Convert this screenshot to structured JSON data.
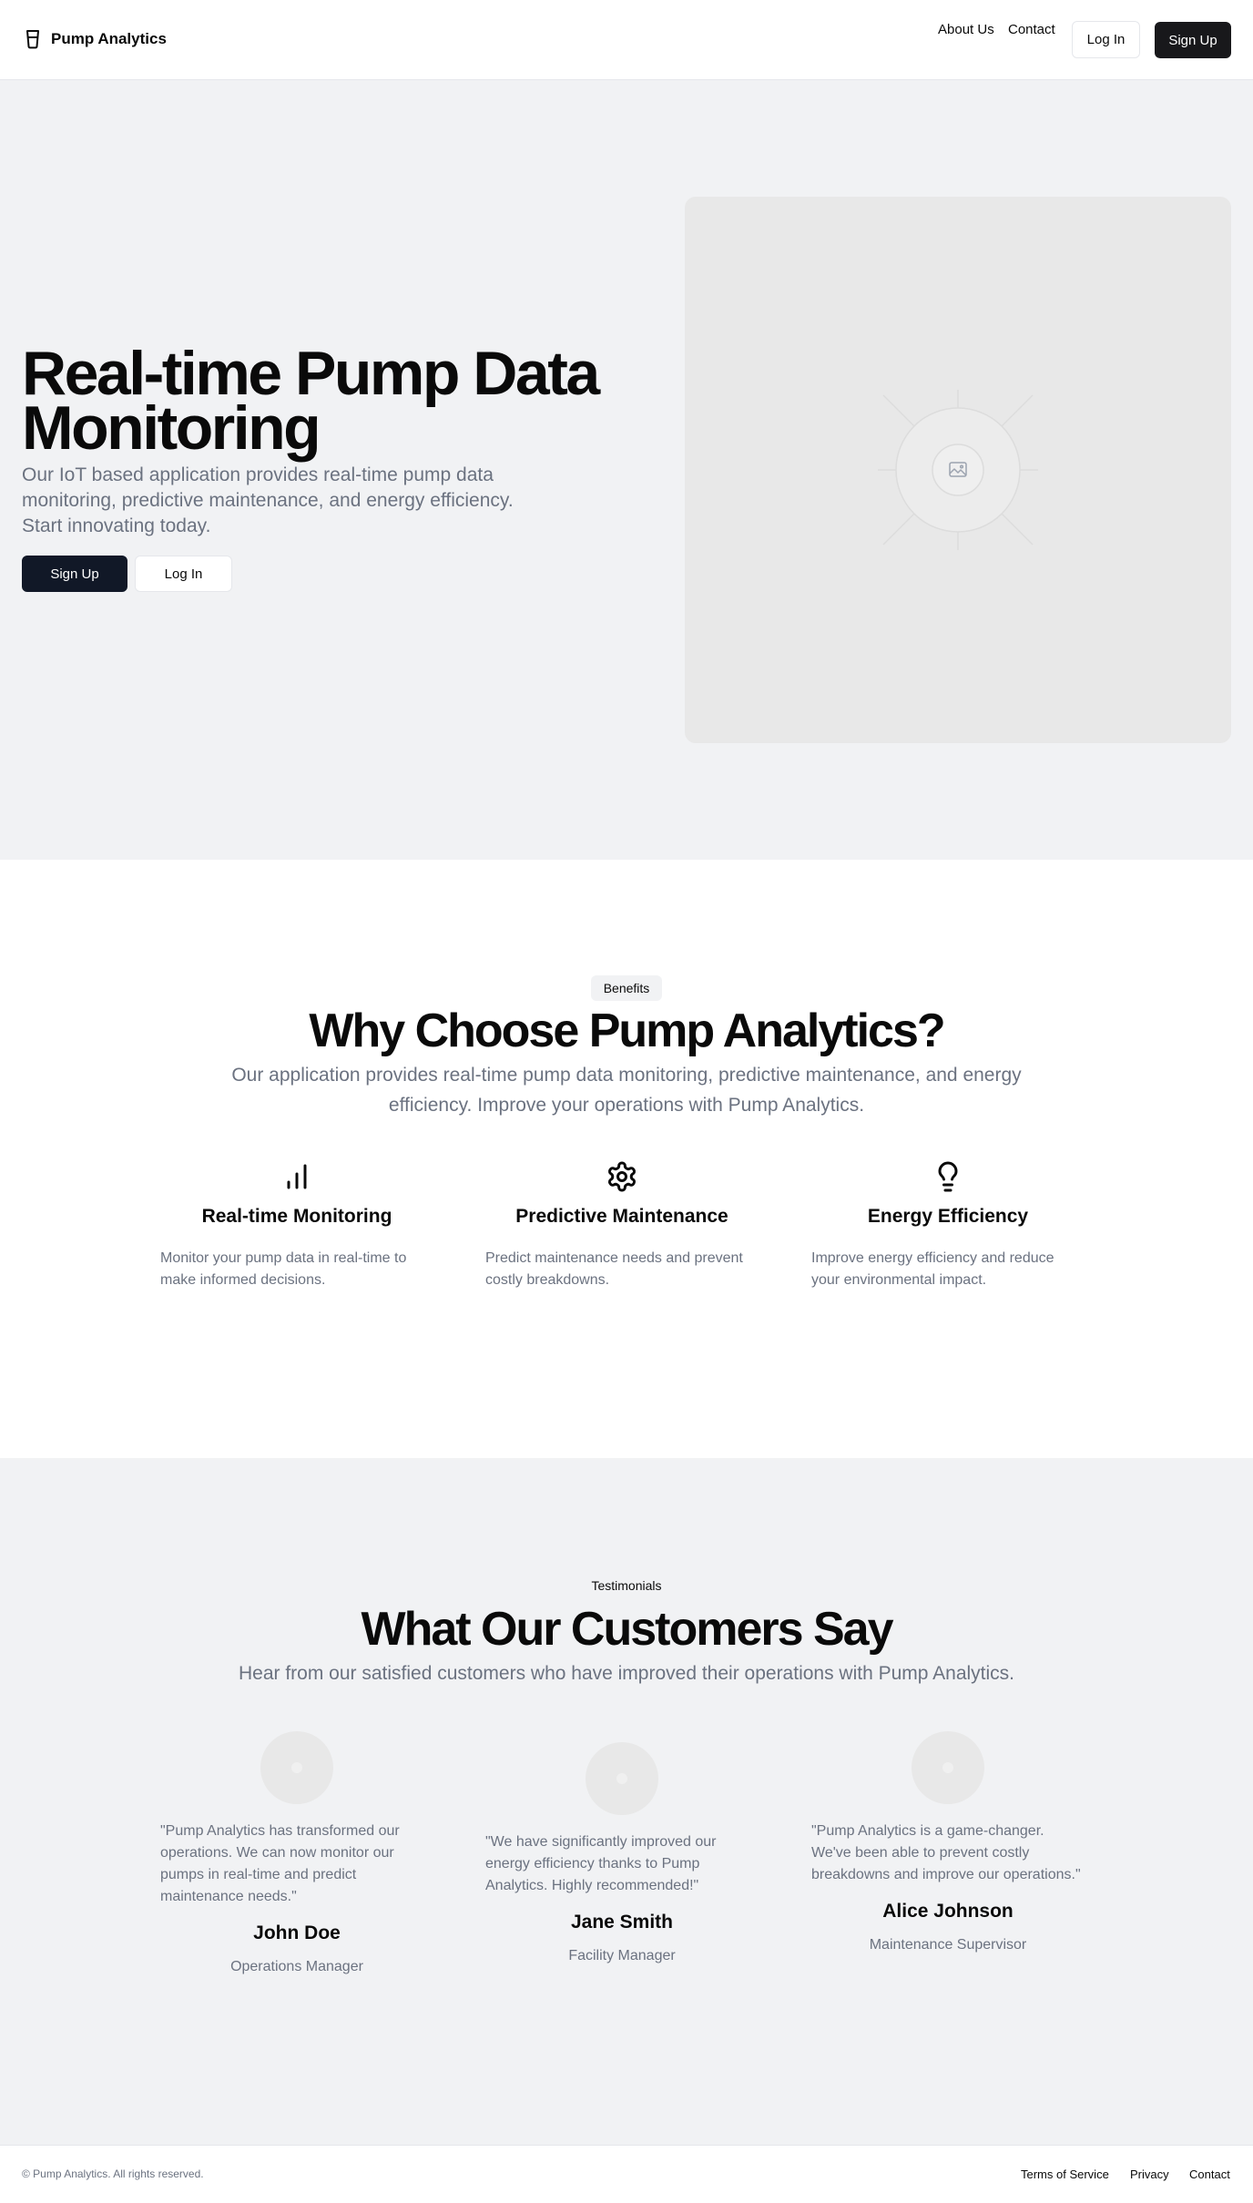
{
  "header": {
    "brand": "Pump Analytics",
    "nav": [
      "About Us",
      "Contact"
    ],
    "login_label": "Log In",
    "signup_label": "Sign Up"
  },
  "hero": {
    "title": "Real-time Pump Data Monitoring",
    "subtitle": "Our IoT based application provides real-time pump data monitoring, predictive maintenance, and energy efficiency. Start innovating today.",
    "signup_label": "Sign Up",
    "login_label": "Log In",
    "image_icon": "image-placeholder-icon"
  },
  "benefits": {
    "badge": "Benefits",
    "title": "Why Choose Pump Analytics?",
    "subtitle": "Our application provides real-time pump data monitoring, predictive maintenance, and energy efficiency. Improve your operations with Pump Analytics.",
    "features": [
      {
        "icon": "bar-chart-icon",
        "title": "Real-time Monitoring",
        "description": "Monitor your pump data in real-time to make informed decisions."
      },
      {
        "icon": "gear-icon",
        "title": "Predictive Maintenance",
        "description": "Predict maintenance needs and prevent costly breakdowns."
      },
      {
        "icon": "lightbulb-icon",
        "title": "Energy Efficiency",
        "description": "Improve energy efficiency and reduce your environmental impact."
      }
    ]
  },
  "testimonials": {
    "label": "Testimonials",
    "title": "What Our Customers Say",
    "subtitle": "Hear from our satisfied customers who have improved their operations with Pump Analytics.",
    "items": [
      {
        "quote": "\"Pump Analytics has transformed our operations. We can now monitor our pumps in real-time and predict maintenance needs.\"",
        "name": "John Doe",
        "role": "Operations Manager"
      },
      {
        "quote": "\"We have significantly improved our energy efficiency thanks to Pump Analytics. Highly recommended!\"",
        "name": "Jane Smith",
        "role": "Facility Manager"
      },
      {
        "quote": "\"Pump Analytics is a game-changer. We've been able to prevent costly breakdowns and improve our operations.\"",
        "name": "Alice Johnson",
        "role": "Maintenance Supervisor"
      }
    ]
  },
  "footer": {
    "copyright": "© Pump Analytics. All rights reserved.",
    "links": [
      "Terms of Service",
      "Privacy",
      "Contact"
    ]
  },
  "colors": {
    "accent_dark": "#18181b",
    "hero_button": "#111827",
    "section_bg": "#f1f2f4",
    "muted_text": "#6b7280"
  }
}
